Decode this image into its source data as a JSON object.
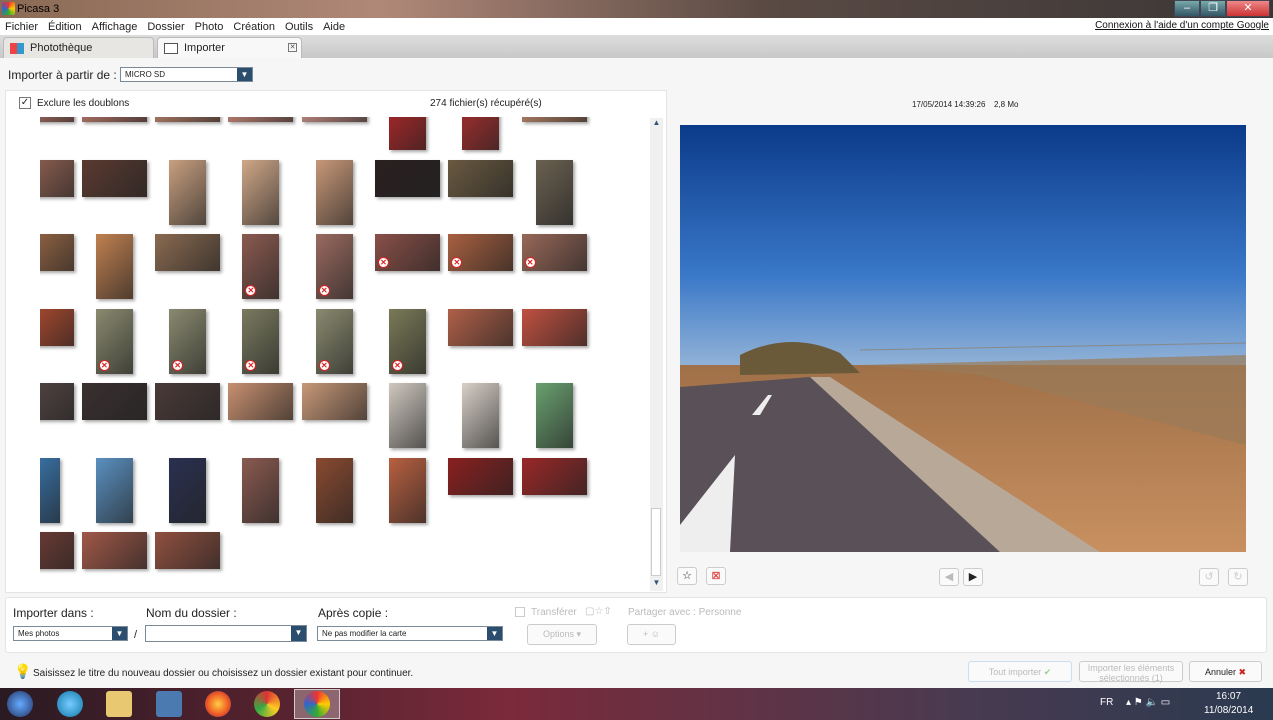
{
  "window": {
    "title": "Picasa 3",
    "min": "–",
    "max": "❐",
    "close": "✕"
  },
  "menu": [
    "Fichier",
    "Édition",
    "Affichage",
    "Dossier",
    "Photo",
    "Création",
    "Outils",
    "Aide"
  ],
  "google_link": "Connexion à l'aide d'un compte Google",
  "tabs": [
    {
      "label": "Photothèque"
    },
    {
      "label": "Importer"
    }
  ],
  "import_from": {
    "label": "Importer à partir de :",
    "value": "MICRO SD"
  },
  "exclude_duplicates": {
    "label": "Exclure les doublons",
    "checked": true
  },
  "file_count": "274 fichier(s) récupéré(s)",
  "preview_info": {
    "date": "17/05/2014 14:39:26",
    "size": "2,8 Mo"
  },
  "thumbnails": [
    [
      [
        "L",
        "#d88a7a",
        0
      ],
      [
        "L",
        "#c98070",
        0
      ],
      [
        "L",
        "#c58a70",
        0
      ],
      [
        "L",
        "#d89080",
        0
      ],
      [
        "L",
        "#d89a90",
        0
      ],
      [
        "P",
        "#c0282a",
        0
      ],
      [
        "P",
        "#b83030",
        0
      ],
      [
        "L",
        "#c89070",
        0
      ]
    ],
    [
      [
        "L",
        "#a06a5a",
        0
      ],
      [
        "L",
        "#5a3a30",
        0
      ],
      [
        "P",
        "#c8a080",
        0
      ],
      [
        "P",
        "#d0a888",
        0
      ],
      [
        "P",
        "#c89878",
        0
      ],
      [
        "L",
        "#2a2020",
        0
      ],
      [
        "L",
        "#6a5a40",
        0
      ],
      [
        "P",
        "#6a6050",
        0
      ]
    ],
    [
      [
        "L",
        "#a8704a",
        0
      ],
      [
        "P",
        "#c08050",
        0
      ],
      [
        "L",
        "#8a6a50",
        0
      ],
      [
        "P",
        "#8a5a50",
        1
      ],
      [
        "P",
        "#9a6a60",
        1
      ],
      [
        "L",
        "#8a5048",
        1
      ],
      [
        "L",
        "#a86040",
        1
      ],
      [
        "L",
        "#986858",
        1
      ]
    ],
    [
      [
        "L",
        "#c05030",
        1
      ],
      [
        "P",
        "#8a8a70",
        1
      ],
      [
        "P",
        "#8a8a70",
        1
      ],
      [
        "P",
        "#7a7a60",
        1
      ],
      [
        "P",
        "#8a8a70",
        1
      ],
      [
        "P",
        "#7a7a58",
        1
      ],
      [
        "L",
        "#b06048",
        0
      ],
      [
        "L",
        "#c05040",
        0
      ]
    ],
    [
      [
        "L",
        "#5a4a48",
        0
      ],
      [
        "L",
        "#3a3030",
        0
      ],
      [
        "L",
        "#4a3a38",
        0
      ],
      [
        "L",
        "#c89070",
        0
      ],
      [
        "L",
        "#c89878",
        0
      ],
      [
        "P",
        "#d0c8c0",
        0
      ],
      [
        "P",
        "#d8d0c8",
        0
      ],
      [
        "P",
        "#6aa070",
        0
      ]
    ],
    [
      [
        "P",
        "#3a78b0",
        0
      ],
      [
        "P",
        "#5a90c0",
        0
      ],
      [
        "P",
        "#2a3050",
        0
      ],
      [
        "P",
        "#8a5a50",
        0
      ],
      [
        "P",
        "#8a4a30",
        0
      ],
      [
        "P",
        "#b86040",
        0
      ],
      [
        "L",
        "#8a2020",
        0
      ],
      [
        "L",
        "#9a2828",
        0
      ]
    ],
    [
      [
        "L",
        "#7a4038",
        0
      ],
      [
        "L",
        "#a05848",
        0
      ],
      [
        "L",
        "#905040",
        0
      ]
    ]
  ],
  "bottom": {
    "import_into": {
      "label": "Importer dans :",
      "value": "Mes photos"
    },
    "separator": "/",
    "folder_name": {
      "label": "Nom du dossier :",
      "value": ""
    },
    "after_copy": {
      "label": "Après copie :",
      "value": "Ne pas modifier la carte"
    },
    "transfer": "Transférer",
    "share": "Partager avec :  Personne",
    "options": "Options",
    "add_people": "+ ☺"
  },
  "hint": "Saisissez le titre du nouveau dossier ou choisissez un dossier existant pour continuer.",
  "actions": {
    "import_all": "Tout importer",
    "import_selected": "Importer les éléments sélectionnés (1)",
    "cancel": "Annuler"
  },
  "tray": {
    "lang": "FR",
    "time": "16:07",
    "date": "11/08/2014"
  }
}
